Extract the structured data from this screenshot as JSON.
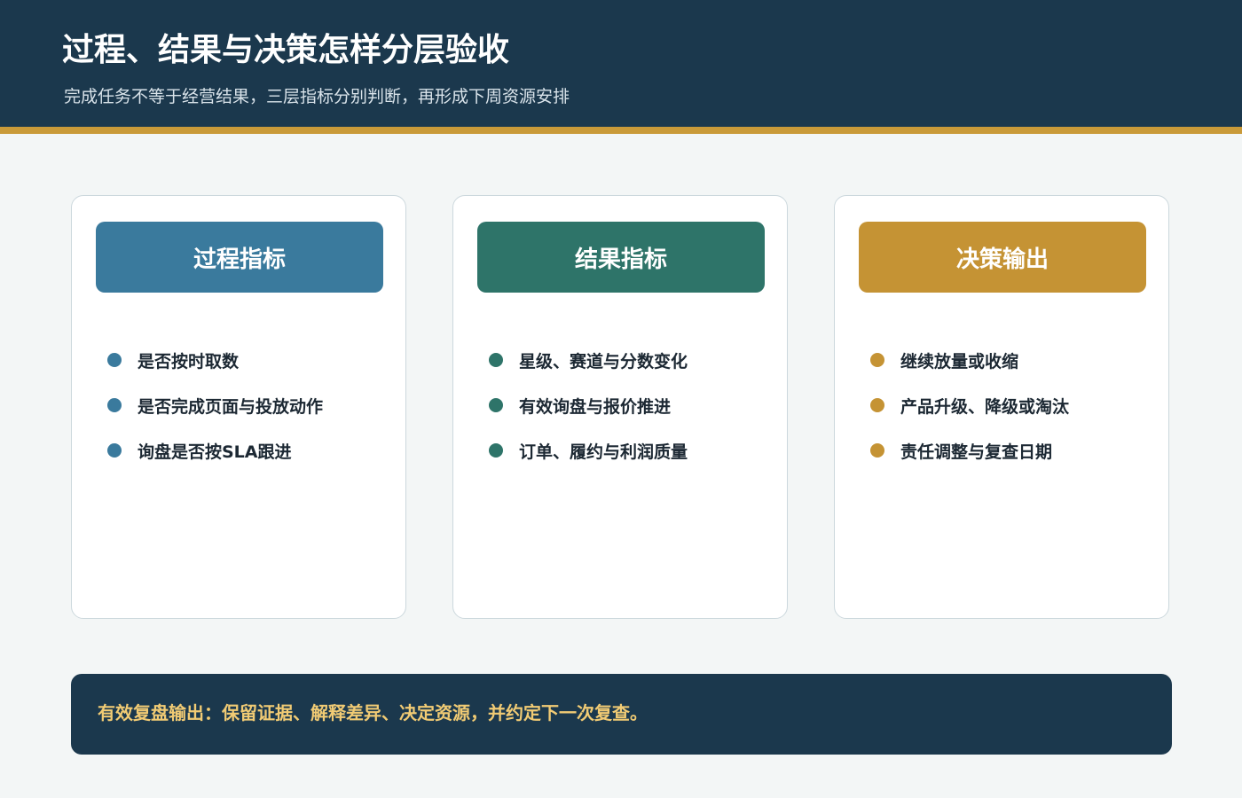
{
  "header": {
    "title": "过程、结果与决策怎样分层验收",
    "subtitle": "完成任务不等于经营结果，三层指标分别判断，再形成下周资源安排"
  },
  "cards": [
    {
      "title": "过程指标",
      "color": "#3a7a9d",
      "items": [
        "是否按时取数",
        "是否完成页面与投放动作",
        "询盘是否按SLA跟进"
      ]
    },
    {
      "title": "结果指标",
      "color": "#2e7469",
      "items": [
        "星级、赛道与分数变化",
        "有效询盘与报价推进",
        "订单、履约与利润质量"
      ]
    },
    {
      "title": "决策输出",
      "color": "#c59334",
      "items": [
        "继续放量或收缩",
        "产品升级、降级或淘汰",
        "责任调整与复查日期"
      ]
    }
  ],
  "footer": {
    "text": "有效复盘输出：保留证据、解释差异、决定资源，并约定下一次复查。"
  },
  "colors": {
    "header_bg": "#1b384d",
    "accent_rule": "#c99a39",
    "footer_text": "#f1cb74"
  }
}
